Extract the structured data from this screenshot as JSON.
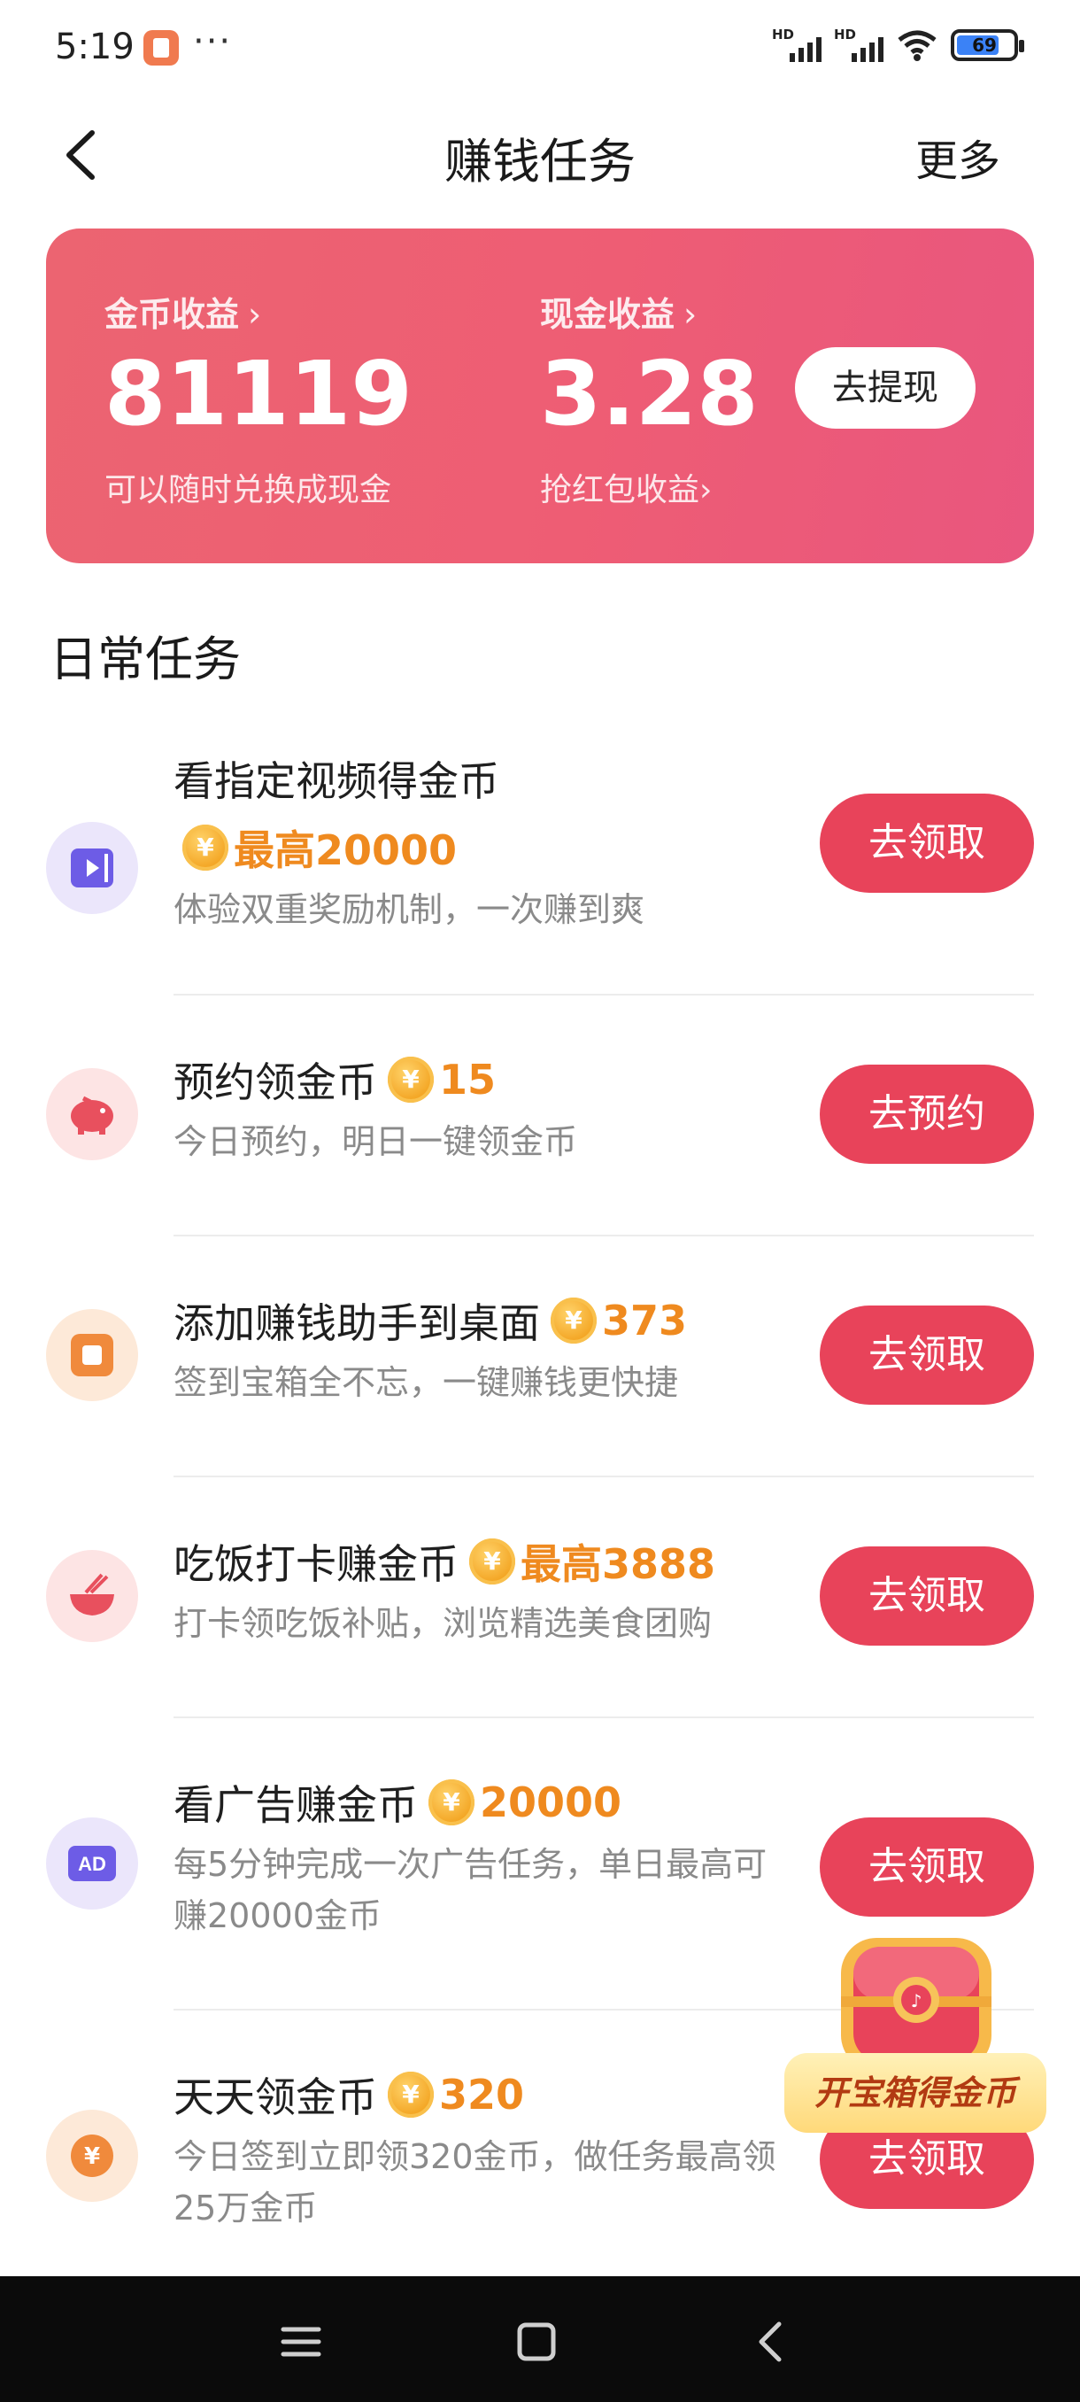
{
  "status_bar": {
    "time": "5:19",
    "more": "···",
    "battery": "69",
    "signal_labels": [
      "HD",
      "HD"
    ]
  },
  "header": {
    "title": "赚钱任务",
    "more": "更多"
  },
  "earnings": {
    "coin_label": "金币收益",
    "coin_value": "81119",
    "coin_sub": "可以随时兑换成现金",
    "cash_label": "现金收益",
    "cash_value": "3.28",
    "cash_sub": "抢红包收益",
    "withdraw_button": "去提现",
    "chevron": "›"
  },
  "daily_tasks": {
    "title": "日常任务",
    "coin_symbol": "¥",
    "items": [
      {
        "title": "看指定视频得金币",
        "reward": "最高20000",
        "desc": "体验双重奖励机制，一次赚到爽",
        "button": "去领取",
        "icon": "video-play-icon",
        "icon_color": "#6d5ce6",
        "icon_bg": "#ebe6fb"
      },
      {
        "title": "预约领金币",
        "reward": "15",
        "desc": "今日预约，明日一键领金币",
        "button": "去预约",
        "icon": "piggy-bank-icon",
        "icon_color": "#e8505e",
        "icon_bg": "#fde4e4"
      },
      {
        "title": "添加赚钱助手到桌面",
        "reward": "373",
        "desc": "签到宝箱全不忘，一键赚钱更快捷",
        "button": "去领取",
        "icon": "desktop-app-icon",
        "icon_color": "#f08a3c",
        "icon_bg": "#fde9d8"
      },
      {
        "title": "吃饭打卡赚金币",
        "reward": "最高3888",
        "desc": "打卡领吃饭补贴，浏览精选美食团购",
        "button": "去领取",
        "icon": "rice-bowl-icon",
        "icon_color": "#e8505e",
        "icon_bg": "#fde4e4"
      },
      {
        "title": "看广告赚金币",
        "reward": "20000",
        "desc": "每5分钟完成一次广告任务，单日最高可赚20000金币",
        "button": "去领取",
        "icon": "ad-icon",
        "icon_color": "#6d5ce6",
        "icon_bg": "#ebe6fb"
      },
      {
        "title": "天天领金币",
        "reward": "320",
        "desc": "今日签到立即领320金币，做任务最高领25万金币",
        "button": "去领取",
        "icon": "yen-coin-icon",
        "icon_color": "#f08a3c",
        "icon_bg": "#fde9d8"
      }
    ]
  },
  "chest": {
    "label": "开宝箱得金币"
  },
  "colors": {
    "accent": "#e8435a",
    "reward": "#ef8a1f",
    "card": "#ec6471"
  }
}
